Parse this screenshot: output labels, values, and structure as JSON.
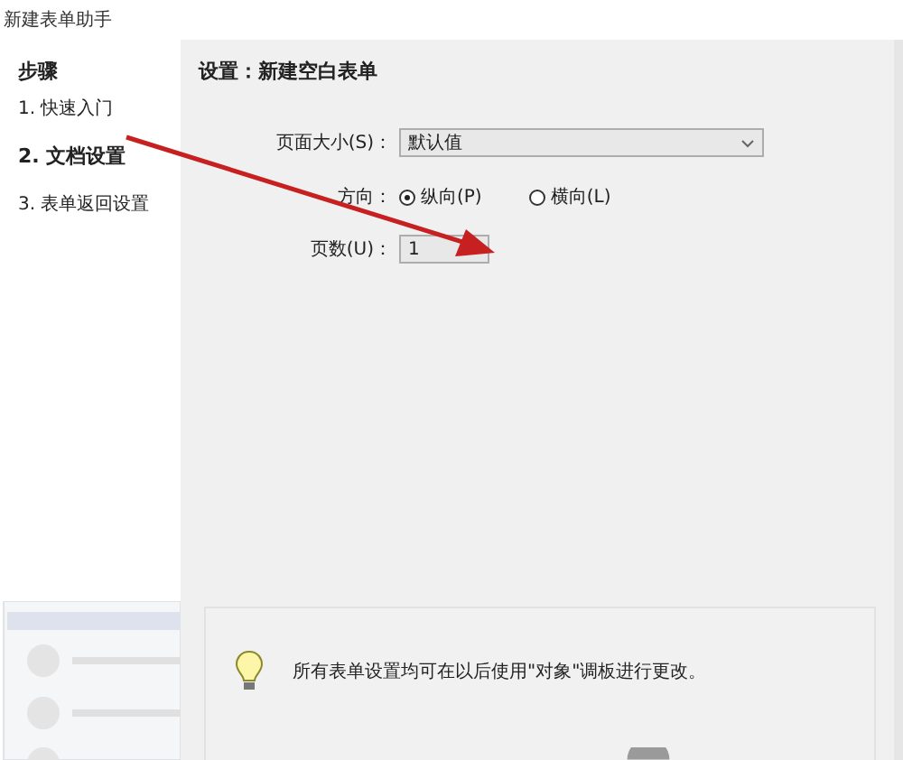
{
  "window": {
    "title": "新建表单助手"
  },
  "sidebar": {
    "heading": "步骤",
    "items": [
      {
        "label": "1. 快速入门",
        "selected": false
      },
      {
        "label": "2. 文档设置",
        "selected": true
      },
      {
        "label": "3. 表单返回设置",
        "selected": false
      }
    ]
  },
  "panel": {
    "heading": "设置：新建空白表单",
    "page_size": {
      "label": "页面大小(S)：",
      "value": "默认值"
    },
    "orientation": {
      "label": "方向：",
      "options": [
        {
          "label": "纵向(P)",
          "selected": true
        },
        {
          "label": "横向(L)",
          "selected": false
        }
      ]
    },
    "page_count": {
      "label": "页数(U)：",
      "value": "1"
    }
  },
  "tip": {
    "text": "所有表单设置均可在以后使用\"对象\"调板进行更改。"
  }
}
